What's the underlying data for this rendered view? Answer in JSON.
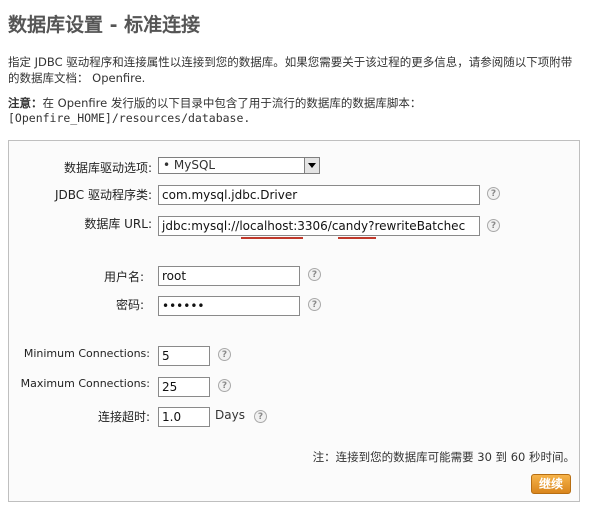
{
  "page": {
    "title": "数据库设置 - 标准连接",
    "description": "指定 JDBC 驱动程序和连接属性以连接到您的数据库。如果您需要关于该过程的更多信息，请参阅随以下项附带的数据库文档： Openfire.",
    "note_label": "注意：",
    "note_text": "在 Openfire 发行版的以下目录中包含了用于流行的数据库的数据库脚本：",
    "note_path": "[Openfire_HOME]/resources/database."
  },
  "form": {
    "driver_label": "数据库驱动选项:",
    "driver_value": "• MySQL",
    "jdbc_label": "JDBC 驱动程序类:",
    "jdbc_value": "com.mysql.jdbc.Driver",
    "url_label": "数据库 URL:",
    "url_value": "jdbc:mysql://localhost:3306/candy?rewriteBatchec",
    "username_label": "用户名:",
    "username_value": "root",
    "password_label": "密码:",
    "password_value": "••••••",
    "min_conn_label": "Minimum Connections:",
    "min_conn_value": "5",
    "max_conn_label": "Maximum Connections:",
    "max_conn_value": "25",
    "timeout_label": "连接超时:",
    "timeout_value": "1.0",
    "timeout_unit": "Days",
    "help_glyph": "?"
  },
  "footer": {
    "note": "注：连接到您的数据库可能需要 30 到 60 秒时间。",
    "continue_label": "继续"
  },
  "colors": {
    "accent_button": "#e39a2e",
    "underline": "#c0392b"
  }
}
